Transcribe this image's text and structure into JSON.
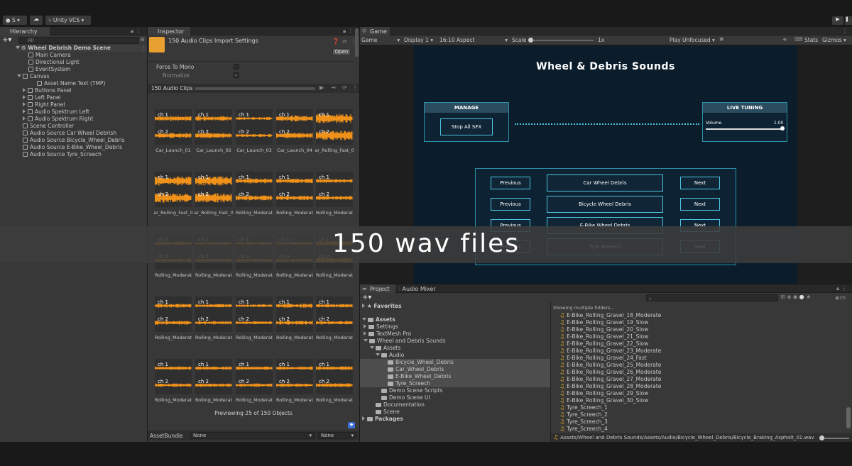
{
  "toolbar": {
    "account": "S",
    "vcs": "Unity VCS"
  },
  "hierarchy": {
    "tab": "Hierarchy",
    "search_placeholder": "All",
    "scene": "Wheel Debrish Demo Scene",
    "items": [
      "Main Camera",
      "Directional Light",
      "EventSystem",
      "Canvas",
      "Asset Name Text (TMP)",
      "Buttons Panel",
      "Left Panel",
      "Right Panel",
      "Audio Spektrum Left",
      "Audio Spektrum Right",
      "Scene Controller",
      "Audio Source Car Wheel Debrish",
      "Audio Source Bicycle_Wheel_Debris",
      "Audio Source E-Bike_Wheel_Debris",
      "Audio Source Tyre_Screech"
    ]
  },
  "inspector": {
    "tab": "Inspector",
    "title": "150 Audio Clips Import Settings",
    "open_button": "Open",
    "force_to_mono": "Force To Mono",
    "normalize": "Normalize",
    "clips_header": "150 Audio Clips",
    "ch1": "ch 1",
    "ch2": "ch 2",
    "thumb_labels": [
      "Car_Launch_01",
      "Car_Launch_02",
      "Car_Launch_03",
      "Car_Launch_04",
      "ar_Rolling_Fast_0",
      "ar_Rolling_Fast_0",
      "ar_Rolling_Fast_0",
      "Rolling_Moderat",
      "Rolling_Moderat",
      "Rolling_Moderat",
      "Rolling_Moderat",
      "Rolling_Moderat",
      "Rolling_Moderat",
      "Rolling_Moderat",
      "Rolling_Moderat",
      "Rolling_Moderat",
      "Rolling_Moderat",
      "Rolling_Moderat",
      "Rolling_Moderat",
      "Rolling_Moderat",
      "Rolling_Moderat",
      "Rolling_Moderat",
      "Rolling_Moderat",
      "Rolling_Moderat",
      "Rolling_Moderat"
    ],
    "previewing": "Previewing 25 of 150 Objects",
    "assetbundle_label": "AssetBundle",
    "assetbundle_value": "None",
    "assetbundle_variant": "None"
  },
  "game": {
    "tab": "Game",
    "display_mode": "Game",
    "display": "Display 1",
    "aspect": "16:10 Aspect",
    "scale_label": "Scale",
    "scale_value": "1x",
    "play_mode": "Play Unfocused",
    "stats": "Stats",
    "gizmos": "Gizmos",
    "title": "Wheel & Debris Sounds",
    "manage_header": "MANAGE",
    "stop_button": "Stop All SFX",
    "live_header": "LIVE TUNING",
    "volume_label": "Volume",
    "volume_value": "1.00",
    "volume_level": 1.0,
    "rows": [
      {
        "prev": "Previous",
        "name": "Car Wheel Debris",
        "next": "Next"
      },
      {
        "prev": "Previous",
        "name": "Bicycle Wheel Debris",
        "next": "Next"
      },
      {
        "prev": "Previous",
        "name": "E-Bike Wheel Debris",
        "next": "Next"
      },
      {
        "prev": "Previous",
        "name": "Tyre Screech",
        "next": "Next"
      }
    ]
  },
  "project": {
    "tab": "Project",
    "tab2": "Audio Mixer",
    "visible_count": "26",
    "favorites": "Favorites",
    "assets": "Assets",
    "tree": [
      "Settings",
      "TextMesh Pro",
      "Wheel and Debris Sounds",
      "Assets",
      "Audio",
      "Bicycle_Wheel_Debris",
      "Car_Wheel_Debris",
      "E-Bike_Wheel_Debris",
      "Tyre_Screech",
      "Demo Scene Scripts",
      "Demo Scene UI",
      "Documentation",
      "Scene"
    ],
    "packages": "Packages",
    "showing": "Showing multiple folders...",
    "files": [
      "E-Bike_Rolling_Gravel_18_Moderate",
      "E-Bike_Rolling_Gravel_19_Slow",
      "E-Bike_Rolling_Gravel_20_Slow",
      "E-Bike_Rolling_Gravel_21_Slow",
      "E-Bike_Rolling_Gravel_22_Slow",
      "E-Bike_Rolling_Gravel_23_Moderate",
      "E-Bike_Rolling_Gravel_24_Fast",
      "E-Bike_Rolling_Gravel_25_Moderate",
      "E-Bike_Rolling_Gravel_26_Moderate",
      "E-Bike_Rolling_Gravel_27_Moderate",
      "E-Bike_Rolling_Gravel_28_Moderate",
      "E-Bike_Rolling_Gravel_29_Slow",
      "E-Bike_Rolling_Gravel_30_Slow",
      "Tyre_Screech_1",
      "Tyre_Screech_2",
      "Tyre_Screech_3",
      "Tyre_Screech_4"
    ],
    "path": "Assets/Wheel and Debris Sounds/Assets/Audio/Bicycle_Wheel_Debris/Bicycle_Braking_Asphalt_01.wav"
  },
  "banner": {
    "text": "150 wav files"
  },
  "colors": {
    "accent": "#4fc3df",
    "waveform": "#f0921a",
    "banner_bg": "#3a3a3a"
  }
}
